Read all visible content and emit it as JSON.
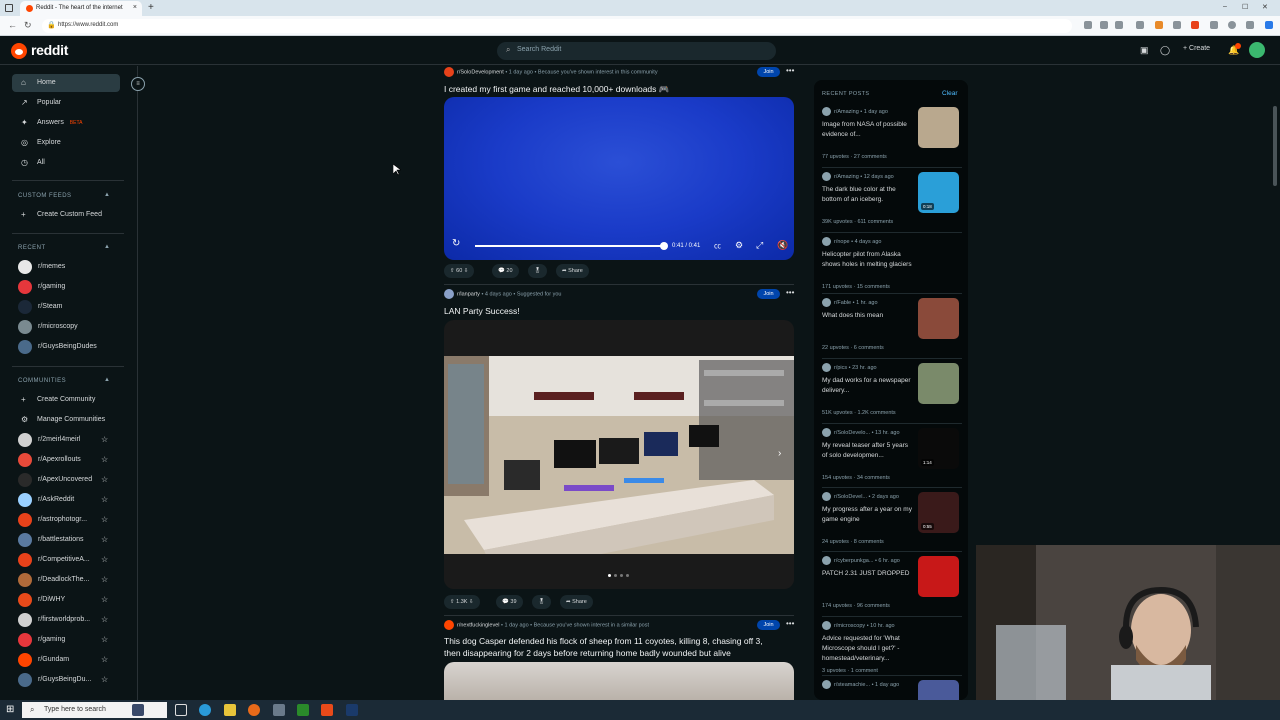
{
  "browser": {
    "tab_title": "Reddit - The heart of the internet",
    "tab_close": "×",
    "new_tab": "+",
    "url": "https://www.reddit.com",
    "win_min": "–",
    "win_max": "☐",
    "win_close": "✕"
  },
  "header": {
    "logo_text": "reddit",
    "search_placeholder": "Search Reddit",
    "create_label": "Create",
    "notif_count": "1"
  },
  "sidebar": {
    "main": [
      {
        "label": "Home",
        "icon": "⌂"
      },
      {
        "label": "Popular",
        "icon": "↗"
      },
      {
        "label": "Answers",
        "icon": "✦",
        "badge": "BETA"
      },
      {
        "label": "Explore",
        "icon": "◎"
      },
      {
        "label": "All",
        "icon": "◷"
      }
    ],
    "custom_feeds_header": "CUSTOM FEEDS",
    "create_custom_feed": "Create Custom Feed",
    "recent_header": "RECENT",
    "recent": [
      {
        "label": "r/memes",
        "color": "#e8e8e8"
      },
      {
        "label": "r/gaming",
        "color": "#e6373c"
      },
      {
        "label": "r/Steam",
        "color": "#1b2838"
      },
      {
        "label": "r/microscopy",
        "color": "#7a8a90"
      },
      {
        "label": "r/GuysBeingDudes",
        "color": "#4a6a8a"
      }
    ],
    "communities_header": "COMMUNITIES",
    "create_community": "Create Community",
    "manage_communities": "Manage Communities",
    "communities": [
      {
        "label": "r/2meirl4meirl",
        "color": "#d0d0d0"
      },
      {
        "label": "r/Apexrollouts",
        "color": "#e84a3a"
      },
      {
        "label": "r/ApexUncovered",
        "color": "#2a2a2a"
      },
      {
        "label": "r/AskReddit",
        "color": "#9ad0ff"
      },
      {
        "label": "r/astrophotogr...",
        "color": "#e8421a"
      },
      {
        "label": "r/battlestations",
        "color": "#5a7aa0"
      },
      {
        "label": "r/CompetitiveA...",
        "color": "#e8421a"
      },
      {
        "label": "r/DeadlockThe...",
        "color": "#b06a3a"
      },
      {
        "label": "r/DiWHY",
        "color": "#e84a1a"
      },
      {
        "label": "r/firstworldprob...",
        "color": "#d0d0d0"
      },
      {
        "label": "r/gaming",
        "color": "#e6373c"
      },
      {
        "label": "r/Gundam",
        "color": "#ff4500"
      },
      {
        "label": "r/GuysBeingDu...",
        "color": "#4a6a8a"
      }
    ]
  },
  "feed": {
    "posts": [
      {
        "subreddit": "r/SoloDevelopment",
        "meta": "• 1 day ago • Because you've shown interest in this community",
        "join": "Join",
        "title": "I created my first game and reached 10,000+ downloads 🎮",
        "video_time": "0:41 / 0:41",
        "upvotes": "60",
        "comments": "20",
        "share": "Share"
      },
      {
        "subreddit": "r/lanparty",
        "meta": "• 4 days ago • Suggested for you",
        "join": "Join",
        "title": "LAN Party Success!",
        "upvotes": "1.3K",
        "comments": "39",
        "share": "Share"
      },
      {
        "subreddit": "r/nextfuckinglevel",
        "meta": "• 1 day ago • Because you've shown interest in a similar post",
        "join": "Join",
        "title_line1": "This dog Casper defended his flock of sheep from 11 coyotes, killing 8, chasing off 3,",
        "title_line2": "then disappearing for 2 days before returning home badly wounded but alive"
      }
    ]
  },
  "recent_posts": {
    "header": "RECENT POSTS",
    "clear": "Clear",
    "items": [
      {
        "sub": "r/Amazing • 1 day ago",
        "title": "Image from NASA of possible evidence of...",
        "stats": "77 upvotes · 27 comments",
        "thumb": "#b9a88e"
      },
      {
        "sub": "r/Amazing • 12 days ago",
        "title": "The dark blue color at the bottom of an iceberg.",
        "stats": "39K upvotes · 611 comments",
        "thumb": "#2a9fd8",
        "dur": "0:18"
      },
      {
        "sub": "r/nope • 4 days ago",
        "title": "Helicopter pilot from Alaska shows holes in melting glaciers",
        "stats": "171 upvotes · 15 comments"
      },
      {
        "sub": "r/Fable • 1 hr. ago",
        "title": "What does this mean",
        "stats": "22 upvotes · 6 comments",
        "thumb": "#8a4a3a"
      },
      {
        "sub": "r/pics • 23 hr. ago",
        "title": "My dad works for a newspaper delivery...",
        "stats": "51K upvotes · 1.2K comments",
        "thumb": "#7a8a6a"
      },
      {
        "sub": "r/SoloDevelo... • 13 hr. ago",
        "title": "My reveal teaser after 5 years of solo developmen...",
        "stats": "154 upvotes · 34 comments",
        "thumb": "#0a0a0a",
        "dur": "1:14"
      },
      {
        "sub": "r/SoloDevel... • 2 days ago",
        "title": "My progress after a year on my game engine",
        "stats": "24 upvotes · 8 comments",
        "thumb": "#3a1a1a",
        "dur": "0:55"
      },
      {
        "sub": "r/cyberpunkga... • 6 hr. ago",
        "title": "PATCH 2.31 JUST DROPPED",
        "stats": "174 upvotes · 96 comments",
        "thumb": "#c81818"
      },
      {
        "sub": "r/microscopy • 10 hr. ago",
        "title": "Advice requested for 'What Microscope should I get?' - homestead/veterinary...",
        "stats": "3 upvotes · 1 comment"
      },
      {
        "sub": "r/steamachie... • 1 day ago",
        "title": "",
        "stats": "",
        "thumb": "#4a5a9a"
      }
    ]
  },
  "taskbar": {
    "search_placeholder": "Type here to search"
  },
  "colors": {
    "accent": "#ff4500",
    "join_blue": "#0045ac",
    "background": "#0b1416"
  }
}
